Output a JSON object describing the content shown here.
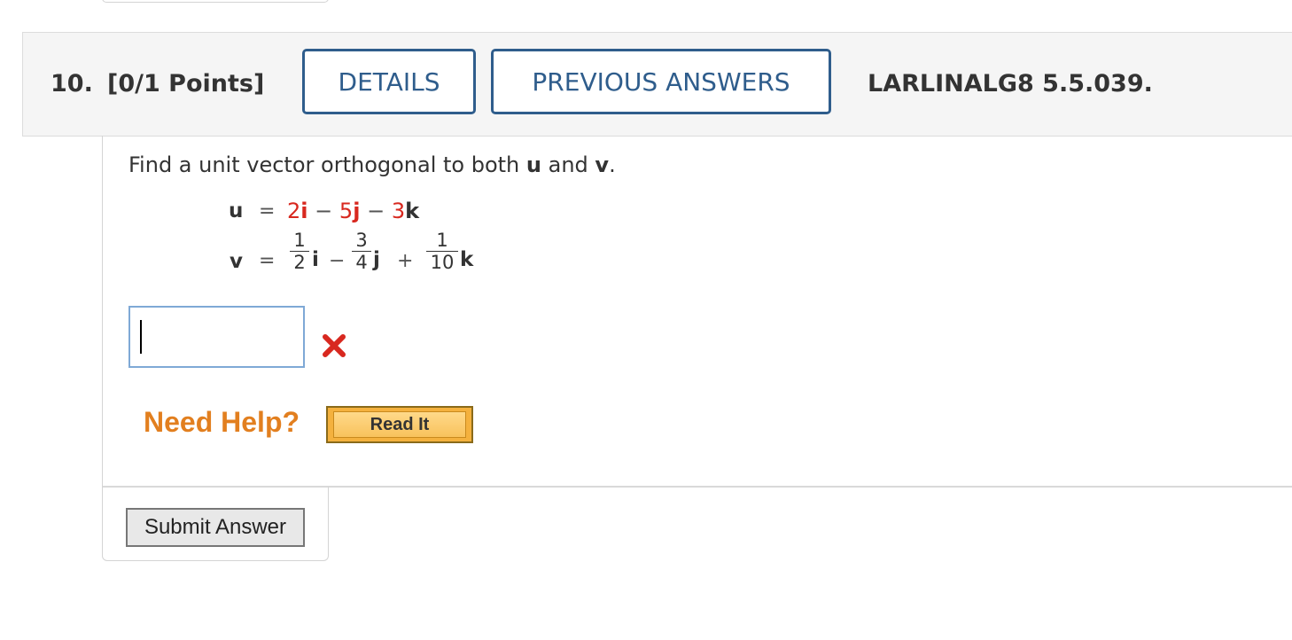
{
  "header": {
    "question_number": "10.",
    "points": "[0/1 Points]",
    "details_label": "DETAILS",
    "previous_answers_label": "PREVIOUS ANSWERS",
    "problem_id": "LARLINALG8 5.5.039."
  },
  "question": {
    "prompt_before_u": "Find a unit vector orthogonal to both ",
    "u_symbol": "u",
    "prompt_and": " and ",
    "v_symbol": "v",
    "prompt_end": ".",
    "equations": {
      "u_lhs": "u",
      "eq_sign": "=",
      "u_c1": "2",
      "u_i": "i",
      "u_op1": "−",
      "u_c2": "5",
      "u_j": "j",
      "u_op2": "−",
      "u_c3": "3",
      "u_k": "k",
      "v_lhs": "v",
      "v_f1_num": "1",
      "v_f1_den": "2",
      "v_i": "i",
      "v_op1": "−",
      "v_f2_num": "3",
      "v_f2_den": "4",
      "v_j": "j",
      "v_op2": "+",
      "v_f3_num": "1",
      "v_f3_den": "10",
      "v_k": "k"
    },
    "answer_value": "",
    "answer_status": "incorrect",
    "status_icon": "red-x-icon",
    "status_color": "#d8281f"
  },
  "help": {
    "label": "Need Help?",
    "read_it_label": "Read It",
    "label_color": "#e27f1f"
  },
  "footer": {
    "submit_label": "Submit Answer"
  }
}
